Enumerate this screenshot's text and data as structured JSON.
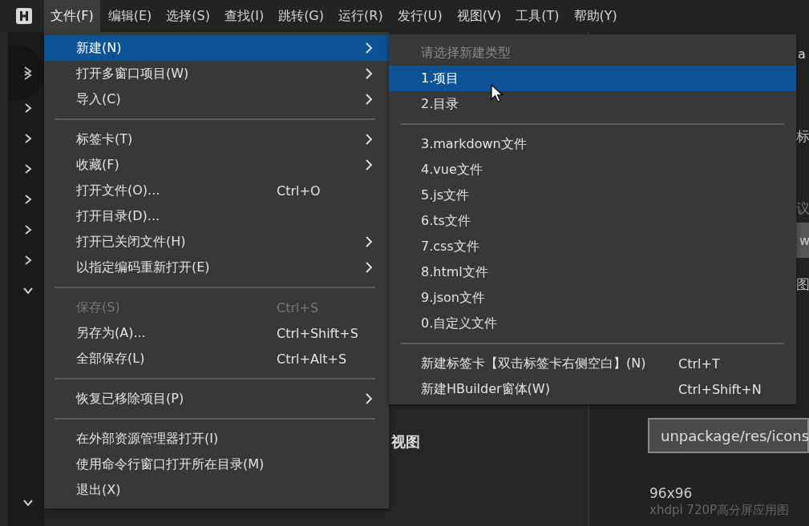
{
  "menu_bar": {
    "items": [
      {
        "label": "文件(F)",
        "selected": true
      },
      {
        "label": "编辑(E)",
        "selected": false
      },
      {
        "label": "选择(S)",
        "selected": false
      },
      {
        "label": "查找(I)",
        "selected": false
      },
      {
        "label": "跳转(G)",
        "selected": false
      },
      {
        "label": "运行(R)",
        "selected": false
      },
      {
        "label": "发行(U)",
        "selected": false
      },
      {
        "label": "视图(V)",
        "selected": false
      },
      {
        "label": "工具(T)",
        "selected": false
      },
      {
        "label": "帮助(Y)",
        "selected": false
      }
    ]
  },
  "sidebar": {
    "toggles": [
      {
        "expanded": false
      },
      {
        "expanded": false
      },
      {
        "expanded": false
      },
      {
        "expanded": false
      },
      {
        "expanded": false
      },
      {
        "expanded": false
      },
      {
        "expanded": true
      },
      {
        "expanded": true
      }
    ]
  },
  "middle_pane": {
    "heading": "视图"
  },
  "right_pane": {
    "fragments": [
      "a",
      "标",
      "议"
    ],
    "field_fragment": "w",
    "fragment_2": "图",
    "path_field": {
      "value": "unpackage/res/icons"
    },
    "size": "96x96",
    "size_note": "xhdpi 720P高分屏应用图"
  },
  "file_menu": {
    "items": [
      {
        "kind": "item",
        "label": "新建(N)",
        "submenu": true,
        "selected": true,
        "disabled": false
      },
      {
        "kind": "item",
        "label": "打开多窗口项目(W)",
        "submenu": true,
        "selected": false,
        "disabled": false
      },
      {
        "kind": "item",
        "label": "导入(C)",
        "submenu": true,
        "selected": false,
        "disabled": false
      },
      {
        "kind": "separator"
      },
      {
        "kind": "item",
        "label": "标签卡(T)",
        "submenu": true,
        "selected": false,
        "disabled": false
      },
      {
        "kind": "item",
        "label": "收藏(F)",
        "submenu": true,
        "selected": false,
        "disabled": false
      },
      {
        "kind": "item",
        "label": "打开文件(O)...",
        "shortcut": "Ctrl+O",
        "submenu": false,
        "selected": false,
        "disabled": false
      },
      {
        "kind": "item",
        "label": "打开目录(D)...",
        "submenu": false,
        "selected": false,
        "disabled": false
      },
      {
        "kind": "item",
        "label": "打开已关闭文件(H)",
        "submenu": true,
        "selected": false,
        "disabled": false
      },
      {
        "kind": "item",
        "label": "以指定编码重新打开(E)",
        "submenu": true,
        "selected": false,
        "disabled": false
      },
      {
        "kind": "separator"
      },
      {
        "kind": "item",
        "label": "保存(S)",
        "shortcut": "Ctrl+S",
        "submenu": false,
        "selected": false,
        "disabled": true
      },
      {
        "kind": "item",
        "label": "另存为(A)...",
        "shortcut": "Ctrl+Shift+S",
        "submenu": false,
        "selected": false,
        "disabled": false
      },
      {
        "kind": "item",
        "label": "全部保存(L)",
        "shortcut": "Ctrl+Alt+S",
        "submenu": false,
        "selected": false,
        "disabled": false
      },
      {
        "kind": "separator"
      },
      {
        "kind": "item",
        "label": "恢复已移除项目(P)",
        "submenu": true,
        "selected": false,
        "disabled": false
      },
      {
        "kind": "separator"
      },
      {
        "kind": "item",
        "label": "在外部资源管理器打开(I)",
        "submenu": false,
        "selected": false,
        "disabled": false
      },
      {
        "kind": "item",
        "label": "使用命令行窗口打开所在目录(M)",
        "submenu": false,
        "selected": false,
        "disabled": false
      },
      {
        "kind": "item",
        "label": "退出(X)",
        "submenu": false,
        "selected": false,
        "disabled": false
      }
    ]
  },
  "new_submenu": {
    "items": [
      {
        "kind": "header",
        "label": "请选择新建类型"
      },
      {
        "kind": "item",
        "label": "1.项目",
        "selected": true
      },
      {
        "kind": "item",
        "label": "2.目录",
        "selected": false
      },
      {
        "kind": "separator"
      },
      {
        "kind": "item",
        "label": "3.markdown文件",
        "selected": false
      },
      {
        "kind": "item",
        "label": "4.vue文件",
        "selected": false
      },
      {
        "kind": "item",
        "label": "5.js文件",
        "selected": false
      },
      {
        "kind": "item",
        "label": "6.ts文件",
        "selected": false
      },
      {
        "kind": "item",
        "label": "7.css文件",
        "selected": false
      },
      {
        "kind": "item",
        "label": "8.html文件",
        "selected": false
      },
      {
        "kind": "item",
        "label": "9.json文件",
        "selected": false
      },
      {
        "kind": "item",
        "label": "0.自定义文件",
        "selected": false
      },
      {
        "kind": "separator"
      },
      {
        "kind": "item",
        "label": "新建标签卡【双击标签卡右侧空白】(N)",
        "shortcut": "Ctrl+T",
        "selected": false
      },
      {
        "kind": "item",
        "label": "新建HBuilder窗体(W)",
        "shortcut": "Ctrl+Shift+N",
        "selected": false
      }
    ]
  }
}
